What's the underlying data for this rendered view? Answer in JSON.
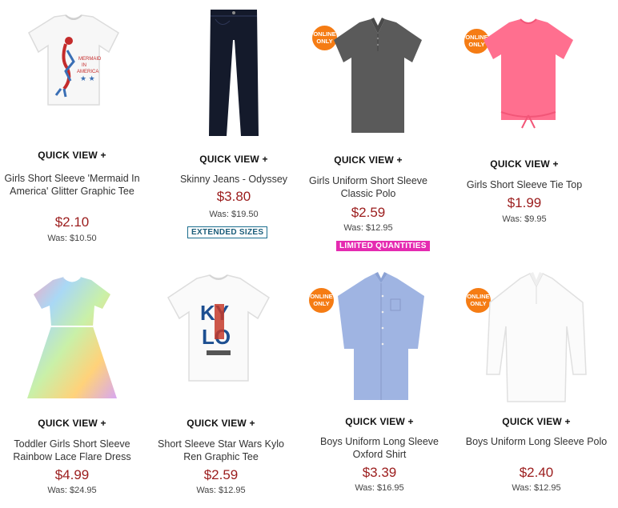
{
  "products": [
    {
      "quick_view": "QUICK VIEW +",
      "name": "Girls Short Sleeve 'Mermaid In America' Glitter Graphic Tee",
      "price": "$2.10",
      "was": "Was: $10.50"
    },
    {
      "quick_view": "QUICK VIEW +",
      "name": "Skinny Jeans - Odyssey",
      "price": "$3.80",
      "was": "Was: $19.50",
      "badge": "EXTENDED SIZES"
    },
    {
      "quick_view": "QUICK VIEW +",
      "name": "Girls Uniform Short Sleeve Classic Polo",
      "price": "$2.59",
      "was": "Was: $12.95",
      "badge": "LIMITED QUANTITIES",
      "online_badge": [
        "ONLINE",
        "ONLY"
      ]
    },
    {
      "quick_view": "QUICK VIEW +",
      "name": "Girls Short Sleeve Tie Top",
      "price": "$1.99",
      "was": "Was: $9.95",
      "online_badge": [
        "ONLINE",
        "ONLY"
      ]
    },
    {
      "quick_view": "QUICK VIEW +",
      "name": "Toddler Girls Short Sleeve Rainbow Lace Flare Dress",
      "price": "$4.99",
      "was": "Was: $24.95"
    },
    {
      "quick_view": "QUICK VIEW +",
      "name": "Short Sleeve Star Wars Kylo Ren Graphic Tee",
      "price": "$2.59",
      "was": "Was: $12.95"
    },
    {
      "quick_view": "QUICK VIEW +",
      "name": "Boys Uniform Long Sleeve Oxford Shirt",
      "price": "$3.39",
      "was": "Was: $16.95",
      "online_badge": [
        "ONLINE",
        "ONLY"
      ]
    },
    {
      "quick_view": "QUICK VIEW +",
      "name": "Boys Uniform Long Sleeve Polo",
      "price": "$2.40",
      "was": "Was: $12.95",
      "online_badge": [
        "ONLINE",
        "ONLY"
      ]
    }
  ],
  "graphics": {
    "mermaid_tee": [
      "MERMAID",
      "IN",
      "AMERICA"
    ],
    "kylo_tee": [
      "KY",
      "LO"
    ]
  },
  "colors": {
    "price": "#9b1c1c",
    "online_badge": "#f57c14",
    "limited_badge": "#e52bb1",
    "extended_badge": "#1b6e8e"
  }
}
